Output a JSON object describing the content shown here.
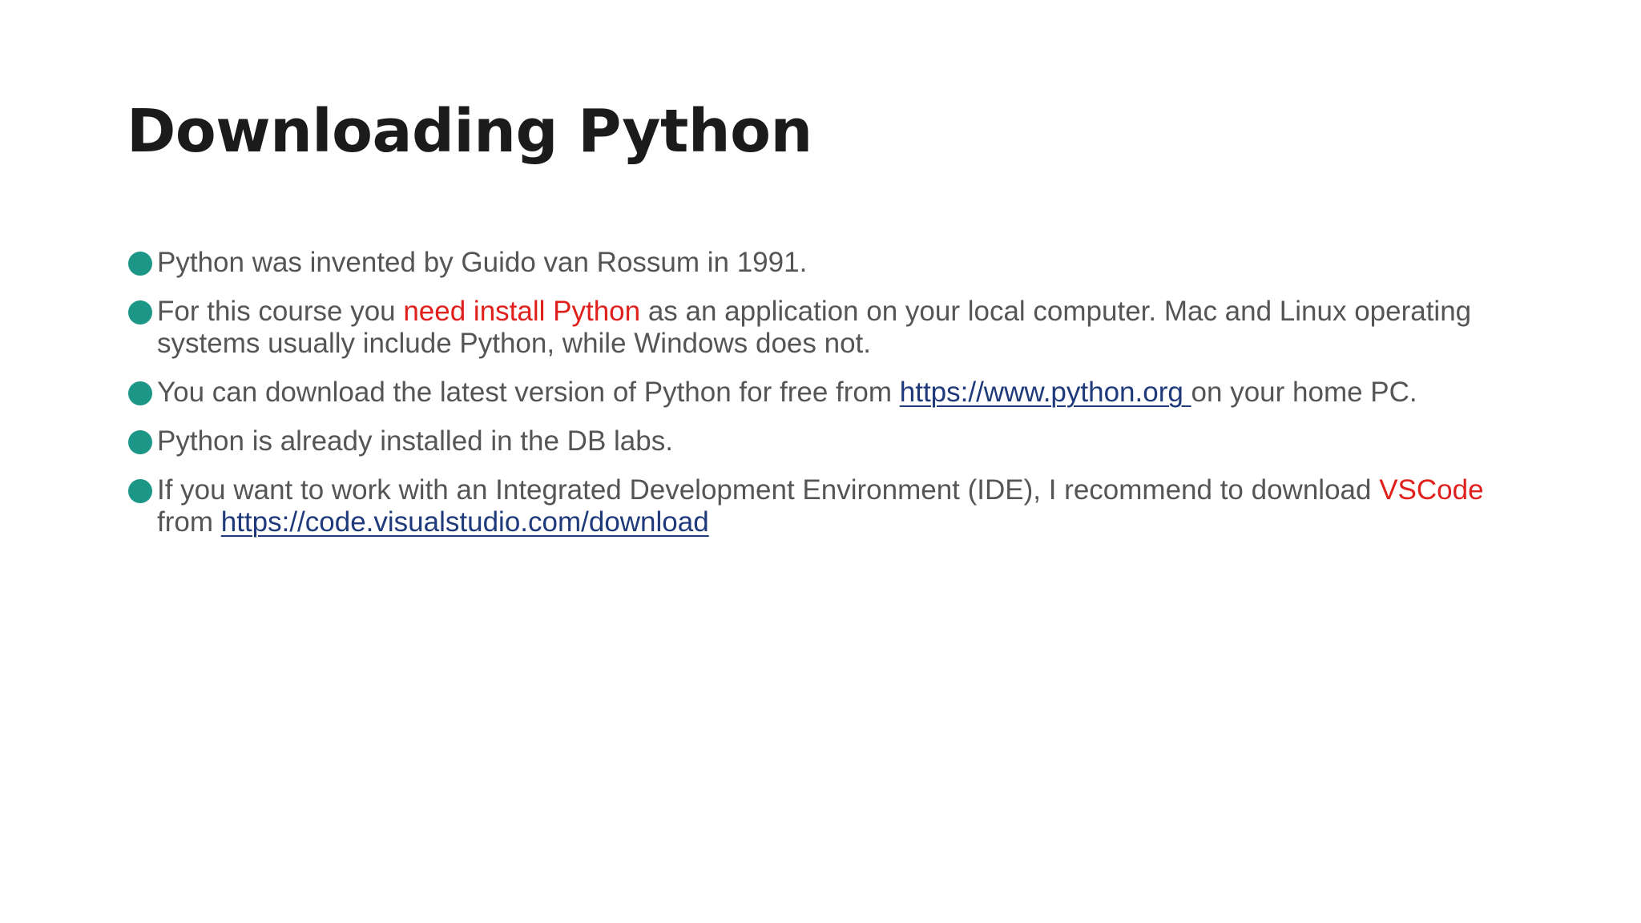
{
  "slide": {
    "title": "Downloading Python",
    "bullet_color": "#1c9686",
    "accent_color": "#e0201c",
    "link_color": "#1f3a7a",
    "bullets": [
      {
        "text": "Python was invented by Guido van Rossum in 1991."
      },
      {
        "text_before": "For this course you ",
        "highlight": "need install Python",
        "text_after": " as an application on your local computer. Mac and Linux operating systems usually include Python, while Windows does not."
      },
      {
        "text_before": "You can download the latest version of Python for free from ",
        "link": "https://www.python.org ",
        "text_after": "on your home PC."
      },
      {
        "text": "Python is already installed in the DB labs."
      },
      {
        "text_before": "If you want to work with an Integrated Development Environment (IDE),  I recommend to download ",
        "highlight": "VSCode",
        "text_middle": " from ",
        "link": "https://code.visualstudio.com/download"
      }
    ]
  }
}
